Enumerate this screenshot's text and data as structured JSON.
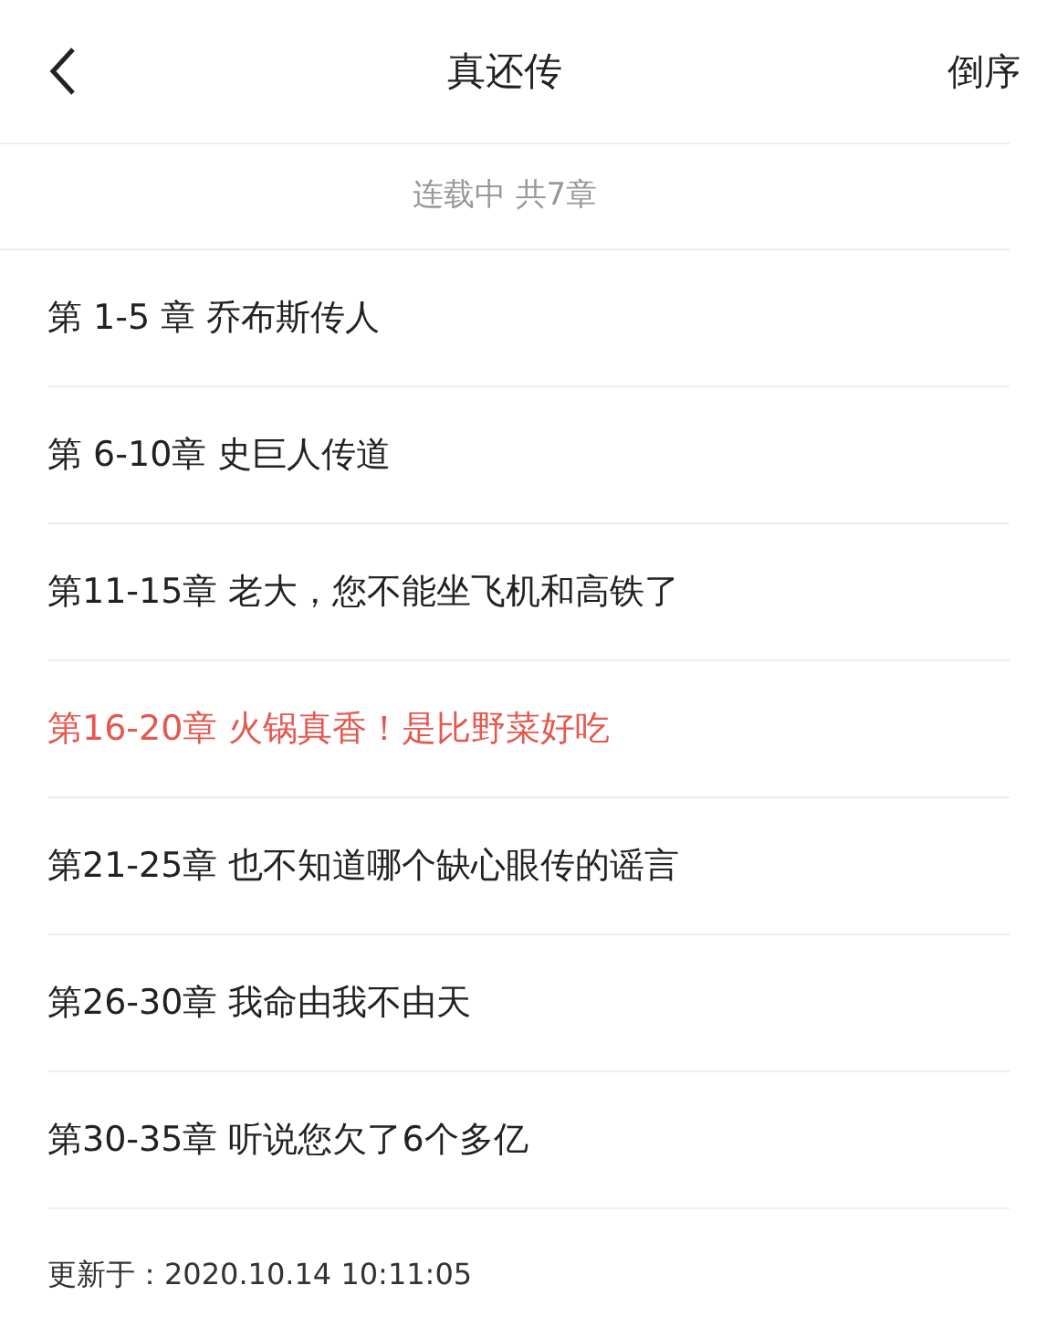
{
  "header": {
    "title": "真还传",
    "sort": "倒序"
  },
  "status": "连载中 共7章",
  "chapters": [
    {
      "label": "第 1-5 章 乔布斯传人",
      "selected": false
    },
    {
      "label": "第 6-10章 史巨人传道",
      "selected": false
    },
    {
      "label": "第11-15章 老大，您不能坐飞机和高铁了",
      "selected": false
    },
    {
      "label": "第16-20章 火锅真香！是比野菜好吃",
      "selected": true
    },
    {
      "label": "第21-25章 也不知道哪个缺心眼传的谣言",
      "selected": false
    },
    {
      "label": "第26-30章 我命由我不由天",
      "selected": false
    },
    {
      "label": "第30-35章 听说您欠了6个多亿",
      "selected": false
    }
  ],
  "updated": "更新于：2020.10.14 10:11:05"
}
